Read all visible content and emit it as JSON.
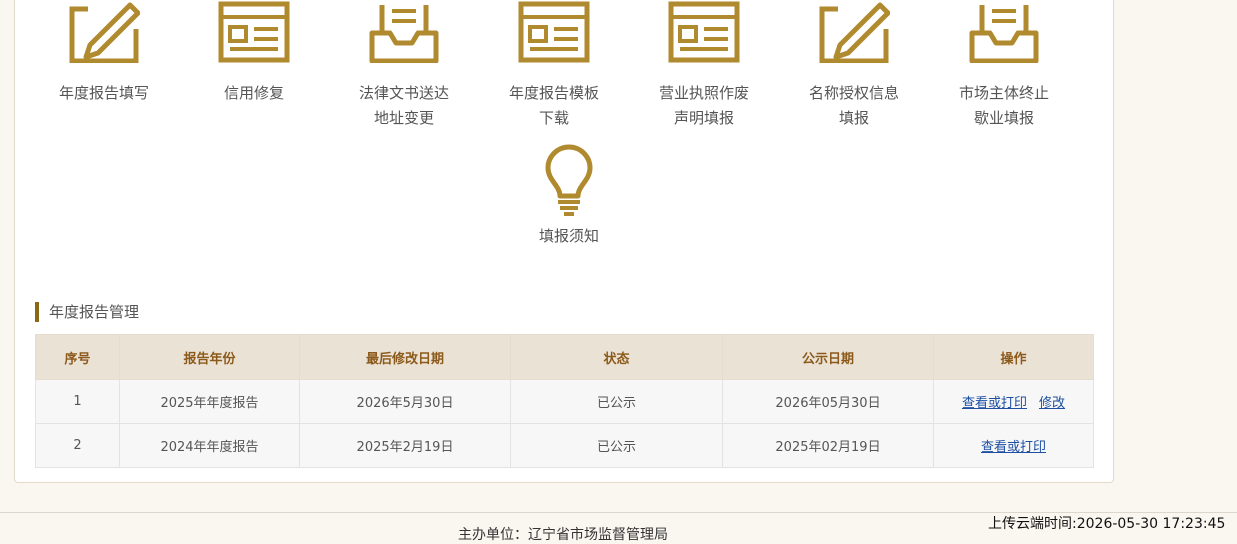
{
  "functions": [
    {
      "label": "年度报告填写",
      "icon": "edit-pencil-icon"
    },
    {
      "label": "信用修复",
      "icon": "form-document-icon"
    },
    {
      "label": "法律文书送达\n地址变更",
      "icon": "inbox-tray-icon"
    },
    {
      "label": "年度报告模板\n下载",
      "icon": "form-document-icon"
    },
    {
      "label": "营业执照作废\n声明填报",
      "icon": "form-document-icon"
    },
    {
      "label": "名称授权信息\n填报",
      "icon": "edit-pencil-icon"
    },
    {
      "label": "市场主体终止\n歇业填报",
      "icon": "inbox-tray-icon"
    },
    {
      "label": "填报须知",
      "icon": "lightbulb-icon"
    }
  ],
  "section": {
    "title": "年度报告管理"
  },
  "table": {
    "headers": [
      "序号",
      "报告年份",
      "最后修改日期",
      "状态",
      "公示日期",
      "操作"
    ],
    "rows": [
      {
        "no": "1",
        "year": "2025年年度报告",
        "modified": "2026年5月30日",
        "status": "已公示",
        "published": "2026年05月30日",
        "actions": [
          "查看或打印",
          "修改"
        ]
      },
      {
        "no": "2",
        "year": "2024年年度报告",
        "modified": "2025年2月19日",
        "status": "已公示",
        "published": "2025年02月19日",
        "actions": [
          "查看或打印"
        ]
      }
    ]
  },
  "footer": {
    "org": "主办单位：辽宁省市场监督管理局",
    "upload_time": "上传云端时间:2026-05-30 17:23:45"
  },
  "colors": {
    "accent": "#b08a2e",
    "header_bg": "#ebe2d6",
    "link": "#1e4fa3"
  }
}
